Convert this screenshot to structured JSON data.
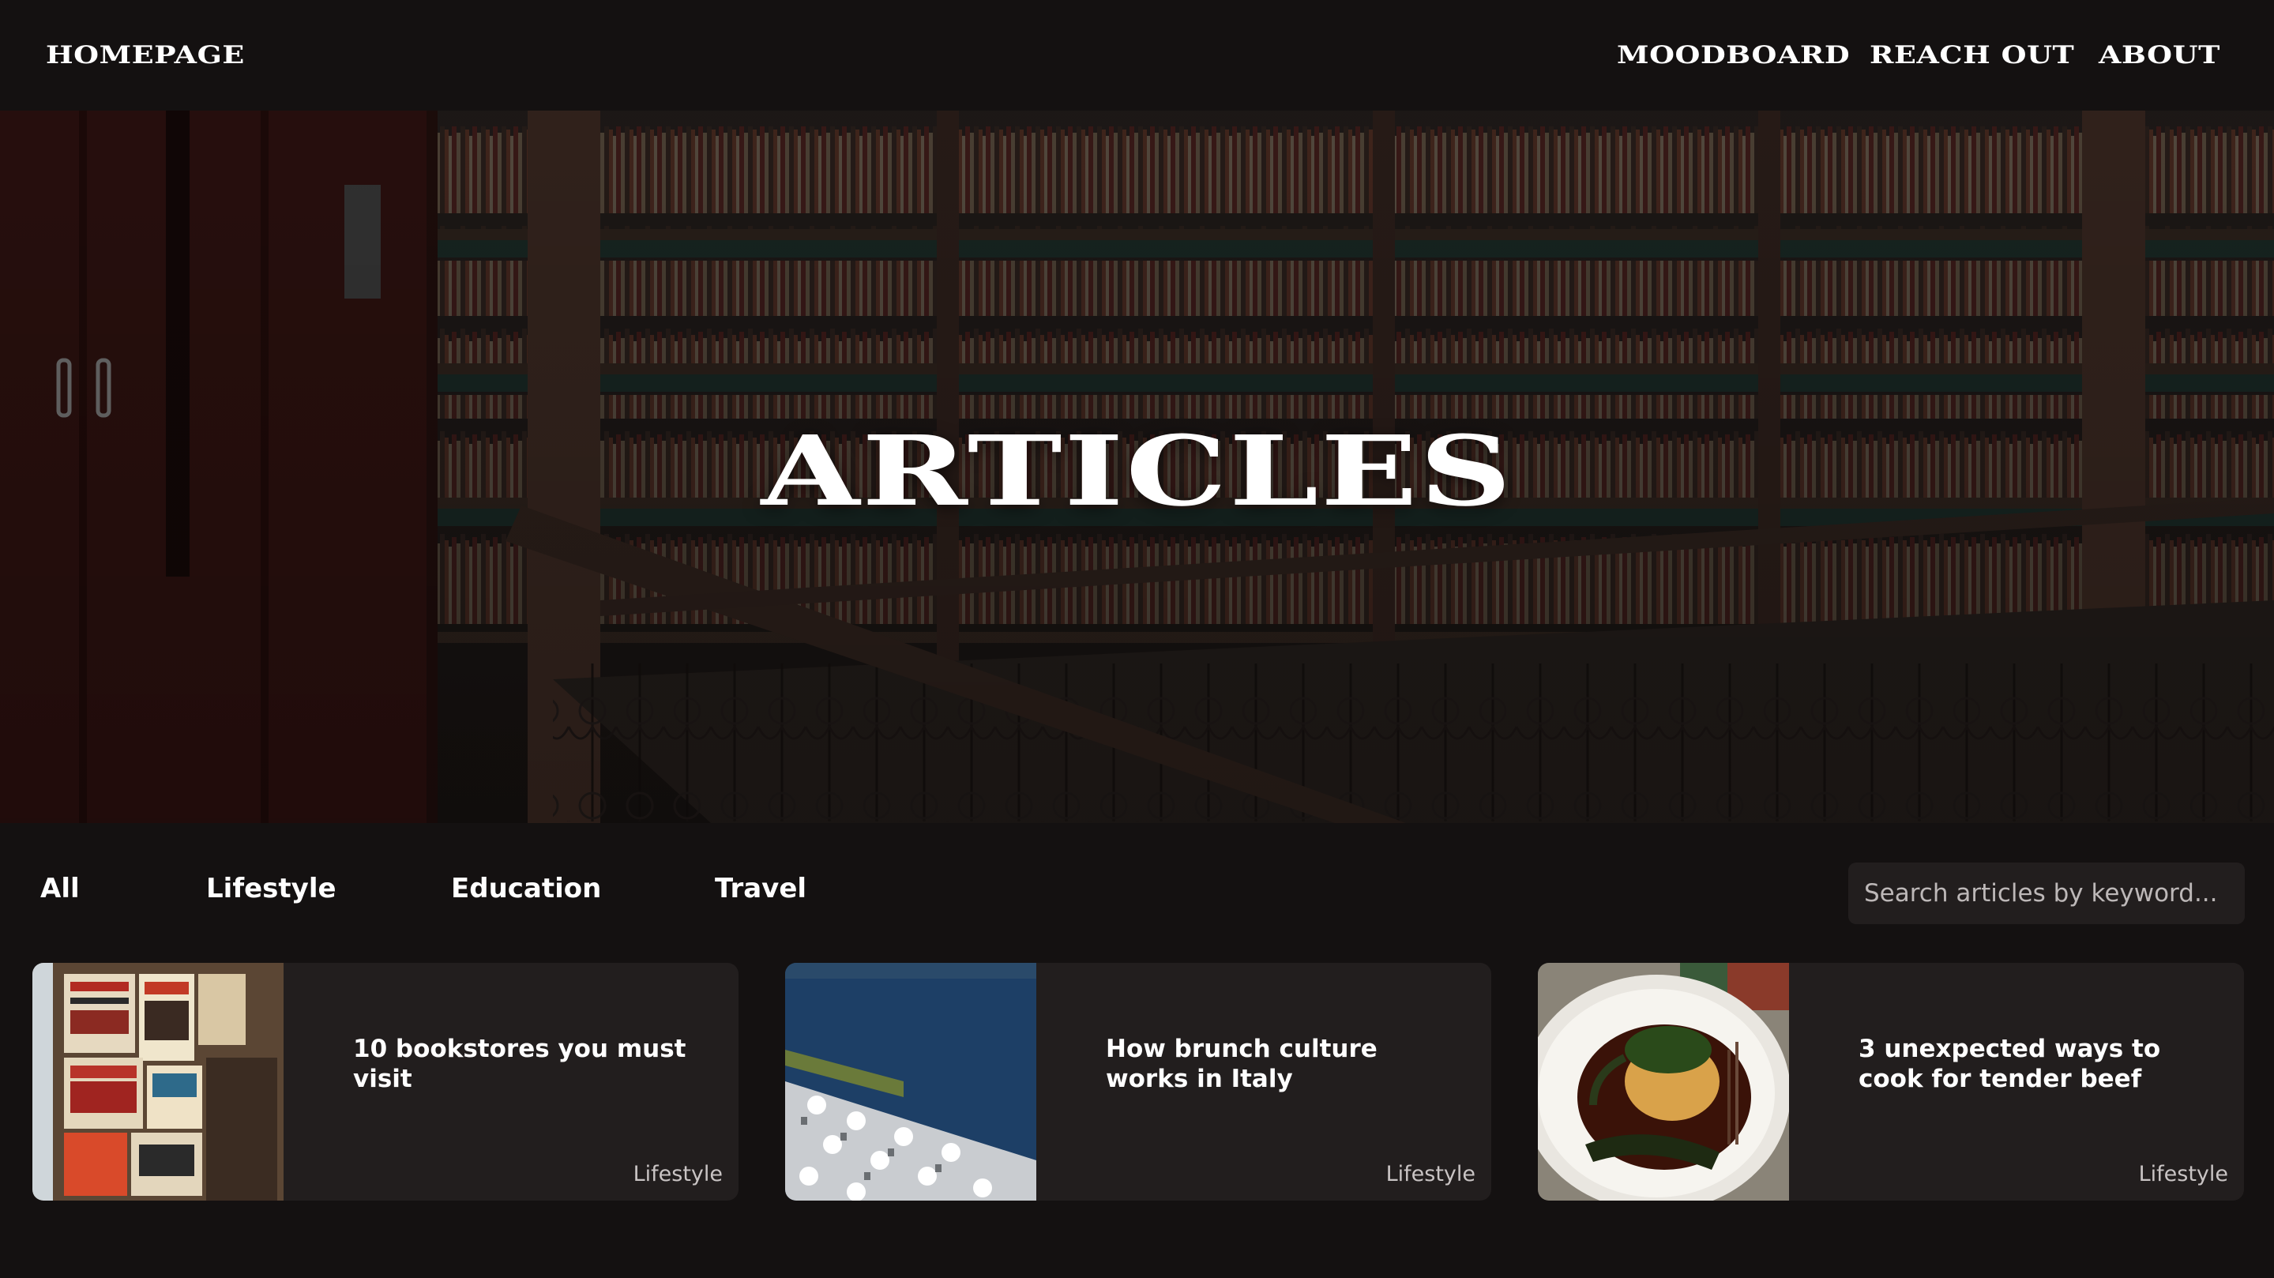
{
  "nav": {
    "brand": "HOMEPAGE",
    "links": [
      "MOODBOARD",
      "REACH OUT",
      "ABOUT"
    ]
  },
  "hero": {
    "title": "ARTICLES"
  },
  "filters": [
    "All",
    "Lifestyle",
    "Education",
    "Travel"
  ],
  "search": {
    "placeholder": "Search articles by keyword..."
  },
  "cards": [
    {
      "title": "10 bookstores you must visit",
      "tag": "Lifestyle"
    },
    {
      "title": "How brunch culture works in Italy",
      "tag": "Lifestyle"
    },
    {
      "title": "3 unexpected ways to cook for tender beef",
      "tag": "Lifestyle"
    }
  ],
  "colors": {
    "background": "#141111",
    "card": "#221e1e",
    "text": "#ffffff",
    "muted": "#c9c4c4"
  }
}
